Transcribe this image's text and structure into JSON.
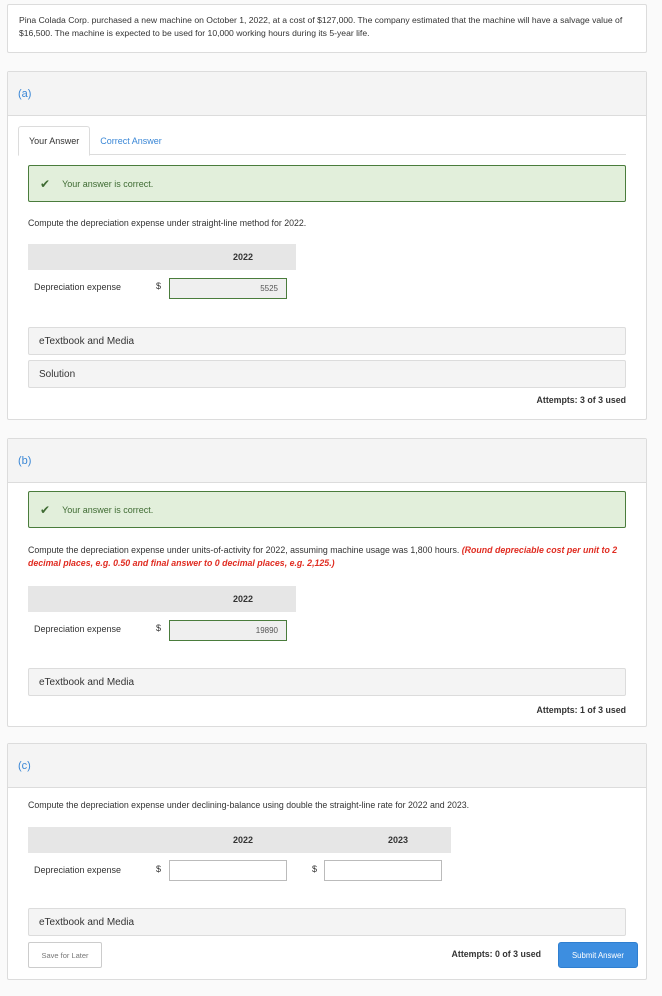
{
  "problem": {
    "text": "Pina Colada Corp. purchased a new machine on October 1, 2022, at a cost of $127,000. The company estimated that the machine will have a salvage value of $16,500. The machine is expected to be used for 10,000 working hours during its 5-year life."
  },
  "parts": [
    {
      "label": "(a)",
      "tabs": [
        "Your Answer",
        "Correct Answer"
      ],
      "correct_message": "Your answer is correct.",
      "instruction": "Compute the depreciation expense under straight-line method for 2022.",
      "columns": [
        "2022"
      ],
      "row_label": "Depreciation expense",
      "currency": "$",
      "values": [
        "5525"
      ],
      "resources": [
        "eTextbook and Media",
        "Solution"
      ],
      "attempts": "Attempts: 3 of 3 used"
    },
    {
      "label": "(b)",
      "correct_message": "Your answer is correct.",
      "instruction": "Compute the depreciation expense under units-of-activity for 2022, assuming machine usage was 1,800 hours.",
      "instruction_note": "(Round depreciable cost per unit to 2 decimal places, e.g. 0.50 and final answer to 0 decimal places, e.g. 2,125.)",
      "columns": [
        "2022"
      ],
      "row_label": "Depreciation expense",
      "currency": "$",
      "values": [
        "19890"
      ],
      "resources": [
        "eTextbook and Media"
      ],
      "attempts": "Attempts: 1 of 3 used"
    },
    {
      "label": "(c)",
      "instruction": "Compute the depreciation expense under declining-balance using double the straight-line rate for 2022 and 2023.",
      "columns": [
        "2022",
        "2023"
      ],
      "row_label": "Depreciation expense",
      "currency": "$",
      "values": [
        "",
        ""
      ],
      "resources": [
        "eTextbook and Media"
      ],
      "save_label": "Save for Later",
      "attempts": "Attempts: 0 of 3 used",
      "submit_label": "Submit Answer"
    }
  ],
  "icons": {
    "check": "checkmark-icon"
  },
  "colors": {
    "accent": "#3a87d6",
    "success_bg": "#e2efdb",
    "success_border": "#4a7c3c",
    "note_red": "#e02b20",
    "submit": "#3d8ee0"
  }
}
